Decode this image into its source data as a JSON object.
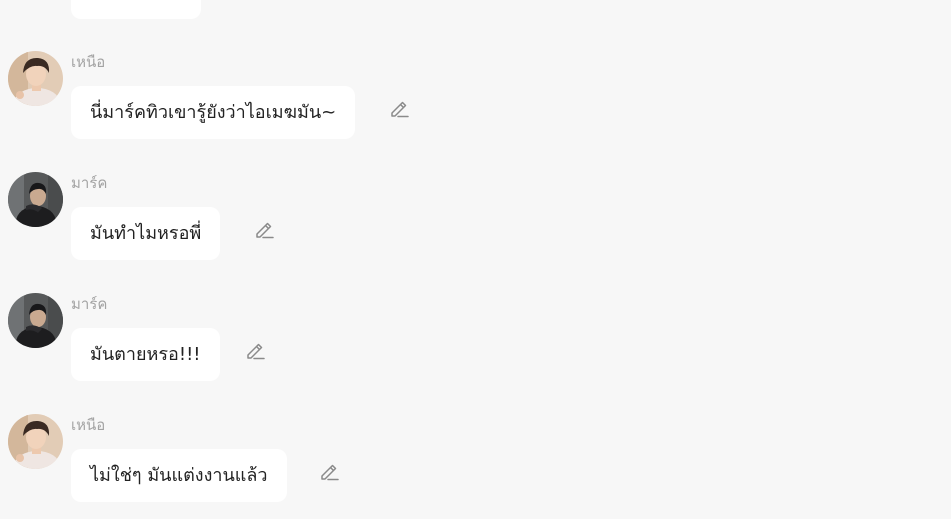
{
  "messages": [
    {
      "sender": "เหนือ",
      "avatar": "nuea-avatar",
      "text": "นี่มาร์คทิวเขารู้ยังว่าไอเมฆมัน~"
    },
    {
      "sender": "มาร์ค",
      "avatar": "mark-avatar",
      "text": "มันทำไมหรอพี่"
    },
    {
      "sender": "มาร์ค",
      "avatar": "mark-avatar",
      "text": "มันตายหรอ!!!"
    },
    {
      "sender": "เหนือ",
      "avatar": "nuea-avatar",
      "text": "ไม่ใช่ๆ มันแต่งงานแล้ว"
    }
  ],
  "icons": {
    "edit": "pencil-icon"
  },
  "colors": {
    "background": "#f7f7f7",
    "bubble": "#ffffff",
    "sender_text": "#a3a3a3",
    "message_text": "#222222",
    "icon": "#8a8a8a"
  }
}
